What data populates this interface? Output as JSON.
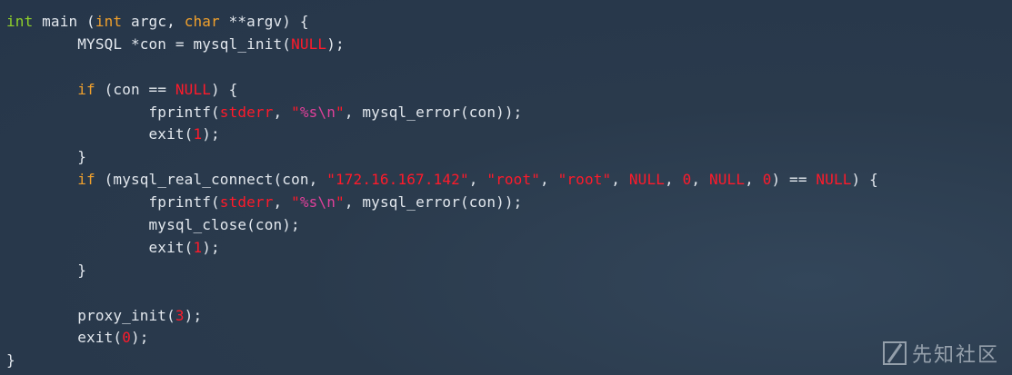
{
  "code": {
    "lines": [
      [
        {
          "t": "int",
          "c": "kw"
        },
        {
          "t": " main (",
          "c": "plain"
        },
        {
          "t": "int",
          "c": "kw2"
        },
        {
          "t": " argc, ",
          "c": "plain"
        },
        {
          "t": "char",
          "c": "kw2"
        },
        {
          "t": " **argv) {",
          "c": "plain"
        }
      ],
      [
        {
          "t": "        MYSQL *con = mysql_init(",
          "c": "plain"
        },
        {
          "t": "NULL",
          "c": "red"
        },
        {
          "t": ");",
          "c": "plain"
        }
      ],
      [],
      [
        {
          "t": "        ",
          "c": "plain"
        },
        {
          "t": "if",
          "c": "kw2"
        },
        {
          "t": " (con == ",
          "c": "plain"
        },
        {
          "t": "NULL",
          "c": "red"
        },
        {
          "t": ") {",
          "c": "plain"
        }
      ],
      [
        {
          "t": "                fprintf(",
          "c": "plain"
        },
        {
          "t": "stderr",
          "c": "red"
        },
        {
          "t": ", ",
          "c": "plain"
        },
        {
          "t": "\"",
          "c": "red"
        },
        {
          "t": "%s\\n",
          "c": "fmt"
        },
        {
          "t": "\"",
          "c": "red"
        },
        {
          "t": ", mysql_error(con));",
          "c": "plain"
        }
      ],
      [
        {
          "t": "                exit(",
          "c": "plain"
        },
        {
          "t": "1",
          "c": "red"
        },
        {
          "t": ");",
          "c": "plain"
        }
      ],
      [
        {
          "t": "        }",
          "c": "plain"
        }
      ],
      [
        {
          "t": "        ",
          "c": "plain"
        },
        {
          "t": "if",
          "c": "kw2"
        },
        {
          "t": " (mysql_real_connect(con, ",
          "c": "plain"
        },
        {
          "t": "\"172.16.167.142\"",
          "c": "red"
        },
        {
          "t": ", ",
          "c": "plain"
        },
        {
          "t": "\"root\"",
          "c": "red"
        },
        {
          "t": ", ",
          "c": "plain"
        },
        {
          "t": "\"root\"",
          "c": "red"
        },
        {
          "t": ", ",
          "c": "plain"
        },
        {
          "t": "NULL",
          "c": "red"
        },
        {
          "t": ", ",
          "c": "plain"
        },
        {
          "t": "0",
          "c": "red"
        },
        {
          "t": ", ",
          "c": "plain"
        },
        {
          "t": "NULL",
          "c": "red"
        },
        {
          "t": ", ",
          "c": "plain"
        },
        {
          "t": "0",
          "c": "red"
        },
        {
          "t": ") == ",
          "c": "plain"
        },
        {
          "t": "NULL",
          "c": "red"
        },
        {
          "t": ") {",
          "c": "plain"
        }
      ],
      [
        {
          "t": "                fprintf(",
          "c": "plain"
        },
        {
          "t": "stderr",
          "c": "red"
        },
        {
          "t": ", ",
          "c": "plain"
        },
        {
          "t": "\"",
          "c": "red"
        },
        {
          "t": "%s\\n",
          "c": "fmt"
        },
        {
          "t": "\"",
          "c": "red"
        },
        {
          "t": ", mysql_error(con));",
          "c": "plain"
        }
      ],
      [
        {
          "t": "                mysql_close(con);",
          "c": "plain"
        }
      ],
      [
        {
          "t": "                exit(",
          "c": "plain"
        },
        {
          "t": "1",
          "c": "red"
        },
        {
          "t": ");",
          "c": "plain"
        }
      ],
      [
        {
          "t": "        }",
          "c": "plain"
        }
      ],
      [],
      [
        {
          "t": "        proxy_init(",
          "c": "plain"
        },
        {
          "t": "3",
          "c": "red"
        },
        {
          "t": ");",
          "c": "plain"
        }
      ],
      [
        {
          "t": "        exit(",
          "c": "plain"
        },
        {
          "t": "0",
          "c": "red"
        },
        {
          "t": ");",
          "c": "plain"
        }
      ],
      [
        {
          "t": "}",
          "c": "plain"
        }
      ]
    ]
  },
  "watermark": {
    "text": "先知社区",
    "icon": "xianzhi-logo-icon"
  }
}
